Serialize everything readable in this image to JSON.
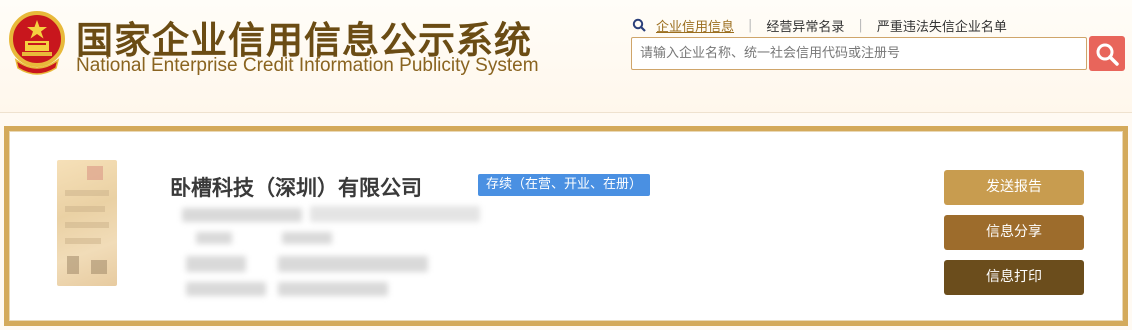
{
  "header": {
    "title_cn": "国家企业信用信息公示系统",
    "title_en": "National Enterprise Credit Information Publicity System",
    "emblem_icon": "national-emblem-icon",
    "links": [
      {
        "label": "企业信用信息",
        "active": true
      },
      {
        "label": "经营异常名录",
        "active": false
      },
      {
        "label": "严重违法失信企业名单",
        "active": false
      }
    ],
    "search": {
      "placeholder": "请输入企业名称、统一社会信用代码或注册号",
      "value": ""
    }
  },
  "company": {
    "name": "卧槽科技（深圳）有限公司",
    "status": "存续（在营、开业、在册）"
  },
  "actions": {
    "report": "发送报告",
    "share": "信息分享",
    "print": "信息打印"
  },
  "colors": {
    "brand": "#6b4c14",
    "card_border": "#d4aa5b",
    "status_badge": "#4a90e2",
    "search_button": "#e8655b"
  }
}
